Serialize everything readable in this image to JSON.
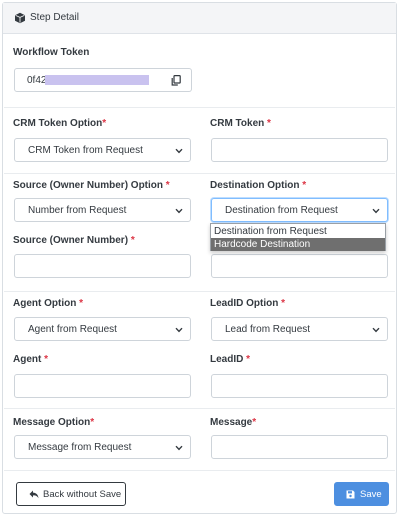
{
  "header": {
    "title": "Step Detail",
    "icon": "cube-icon"
  },
  "workflow_token": {
    "label": "Workflow Token",
    "value_visible": "0f42",
    "copy_icon": "copy-icon"
  },
  "fields": {
    "crm_token_option": {
      "label": "CRM Token Option",
      "required": "*",
      "value": "CRM Token from Request"
    },
    "crm_token": {
      "label": "CRM Token ",
      "required": "*",
      "value": ""
    },
    "source_option": {
      "label": "Source (Owner Number) Option ",
      "required": "*",
      "value": "Number from Request"
    },
    "destination_option": {
      "label": "Destination Option ",
      "required": "*",
      "value": "Destination from Request"
    },
    "source_number": {
      "label": "Source (Owner Number) ",
      "required": "*",
      "value": ""
    },
    "destination_value": {
      "value": ""
    },
    "agent_option": {
      "label": "Agent Option ",
      "required": "*",
      "value": "Agent from Request"
    },
    "leadid_option": {
      "label": "LeadID Option ",
      "required": "*",
      "value": "Lead from Request"
    },
    "agent": {
      "label": "Agent ",
      "required": "*",
      "value": ""
    },
    "leadid": {
      "label": "LeadID ",
      "required": "*",
      "value": ""
    },
    "message_option": {
      "label": "Message Option",
      "required": "*",
      "value": "Message from Request"
    },
    "message": {
      "label": "Message",
      "required": "*",
      "value": ""
    }
  },
  "destination_dropdown": {
    "options": [
      "Destination from Request",
      "Hardcode Destination"
    ],
    "highlighted": "Hardcode Destination"
  },
  "footer": {
    "back_label": "Back without Save",
    "save_label": "Save",
    "back_icon": "reply-arrow-icon",
    "save_icon": "floppy-disk-icon"
  },
  "colors": {
    "required": "#dc3545",
    "save_button": "#4d8fe0",
    "token_mask": "#c9c2ef",
    "focus_border": "#80bdff"
  }
}
